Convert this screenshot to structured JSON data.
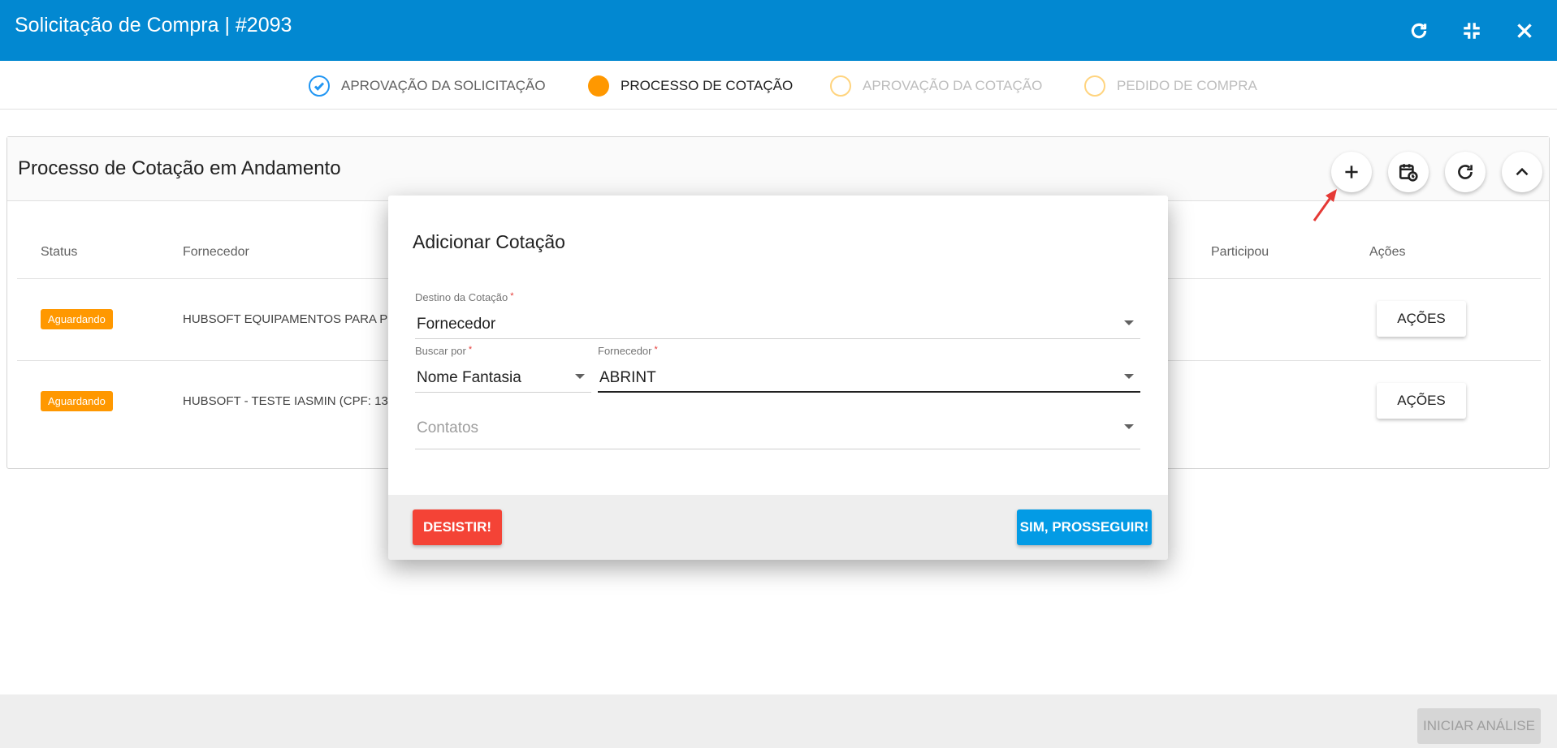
{
  "header": {
    "title": "Solicitação de Compra | #2093",
    "icons": [
      "refresh-icon",
      "collapse-icon",
      "close-icon"
    ]
  },
  "stepper": {
    "steps": [
      {
        "label": "APROVAÇÃO DA SOLICITAÇÃO",
        "state": "done"
      },
      {
        "label": "PROCESSO DE COTAÇÃO",
        "state": "active"
      },
      {
        "label": "APROVAÇÃO DA COTAÇÃO",
        "state": "pending"
      },
      {
        "label": "PEDIDO DE COMPRA",
        "state": "pending"
      }
    ]
  },
  "card": {
    "title": "Processo de Cotação em Andamento",
    "tools": [
      "add-icon",
      "calendar-clock-icon",
      "refresh-icon",
      "chevron-up-icon"
    ],
    "columns": {
      "status": "Status",
      "fornecedor": "Fornecedor",
      "participou": "Participou",
      "acoes": "Ações"
    },
    "rows": [
      {
        "status": "Aguardando",
        "fornecedor": "HUBSOFT EQUIPAMENTOS PARA PI",
        "acoes": "AÇÕES"
      },
      {
        "status": "Aguardando",
        "fornecedor": "HUBSOFT - TESTE IASMIN (CPF: 13",
        "acoes": "AÇÕES"
      }
    ]
  },
  "modal": {
    "title": "Adicionar Cotação",
    "destino": {
      "label": "Destino da Cotação",
      "required": "*",
      "value": "Fornecedor"
    },
    "buscar_por": {
      "label": "Buscar por",
      "required": "*",
      "value": "Nome Fantasia"
    },
    "fornecedor": {
      "label": "Fornecedor",
      "required": "*",
      "value": "ABRINT"
    },
    "contatos": {
      "placeholder": "Contatos"
    },
    "cancel_label": "DESISTIR!",
    "confirm_label": "SIM, PROSSEGUIR!"
  },
  "footer": {
    "start_label": "INICIAR ANÁLISE"
  },
  "colors": {
    "header": "#0288d1",
    "status_waiting": "#ff9800",
    "cancel": "#f44336",
    "confirm": "#039be5"
  }
}
